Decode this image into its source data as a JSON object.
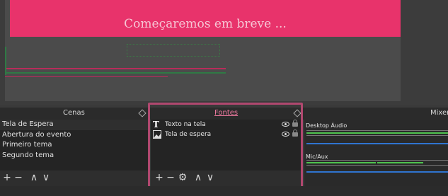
{
  "preview": {
    "banner_text": "Começaremos em breve ...",
    "banner_color": "#e8336b"
  },
  "panels": {
    "scenes_title": "Cenas",
    "sources_title": "Fontes",
    "mixer_title": "Mixer"
  },
  "scenes": {
    "items": [
      {
        "label": "Tela de Espera"
      },
      {
        "label": "Abertura do evento"
      },
      {
        "label": "Primeiro tema"
      },
      {
        "label": "Segundo tema"
      }
    ]
  },
  "sources": {
    "items": [
      {
        "label": "Texto na tela",
        "icon": "text-icon"
      },
      {
        "label": "Tela de espera",
        "icon": "image-icon"
      }
    ]
  },
  "mixer": {
    "channels": [
      {
        "label": "Desktop Áudio"
      },
      {
        "label": "Mic/Aux"
      }
    ]
  },
  "toolbar": {
    "add": "+",
    "remove": "−",
    "settings": "⚙",
    "up": "∧",
    "down": "∨"
  },
  "colors": {
    "highlight": "#b0486f",
    "meter_green": "#4fc34f",
    "meter_blue": "#2f74d0"
  }
}
